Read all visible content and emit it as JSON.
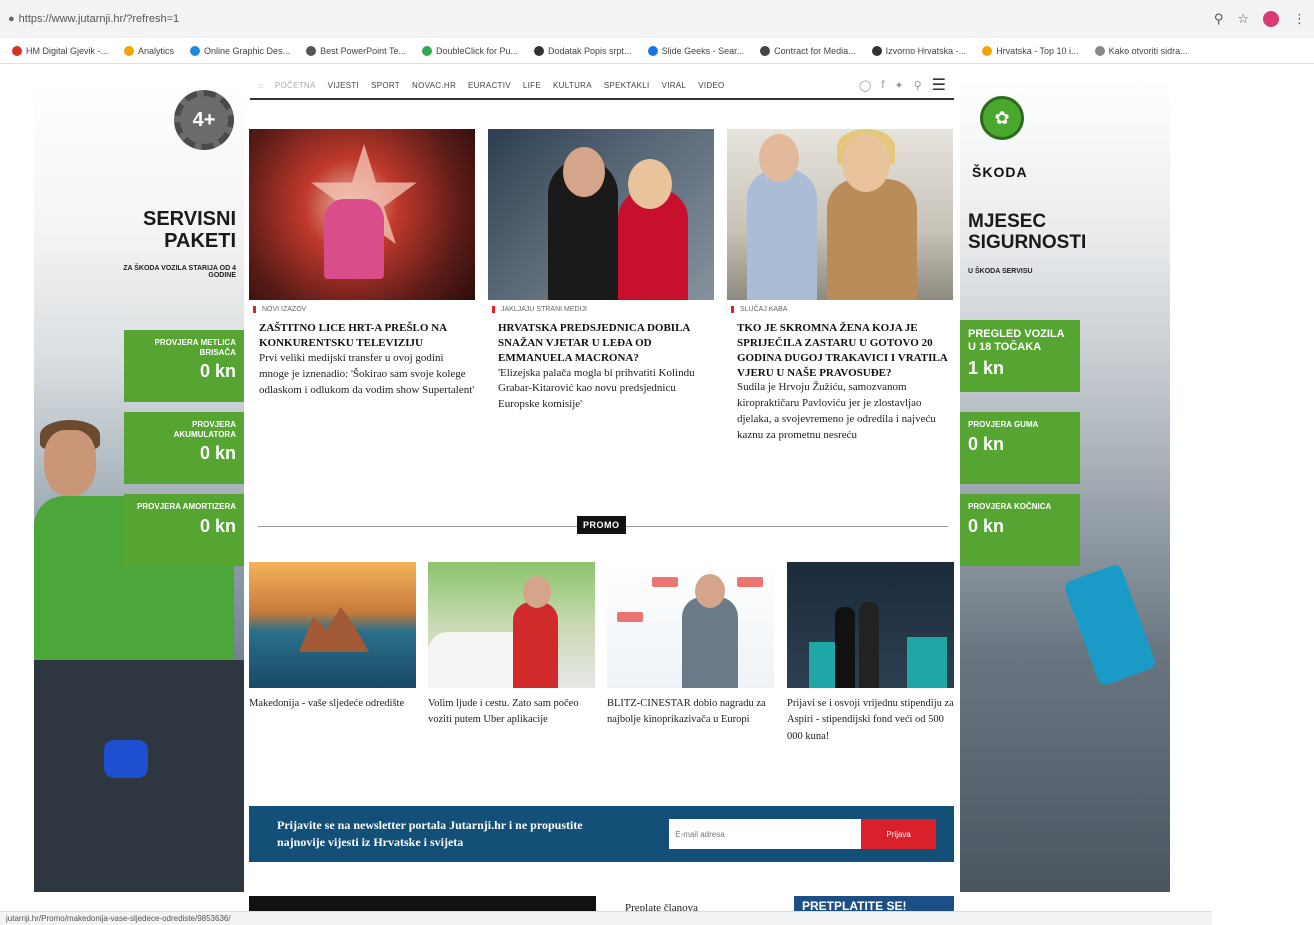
{
  "browser": {
    "url": "https://www.jutarnji.hr/?refresh=1",
    "bookmarks": [
      {
        "label": "HM Digital Gjevik -...",
        "color": "#d93025"
      },
      {
        "label": "Analytics",
        "color": "#f4a400"
      },
      {
        "label": "Online Graphic Des...",
        "color": "#1e88e5"
      },
      {
        "label": "Best PowerPoint Te...",
        "color": "#555555"
      },
      {
        "label": "DoubleClick for Pu...",
        "color": "#34a853"
      },
      {
        "label": "Dodatak Popis srpt...",
        "color": "#333333"
      },
      {
        "label": "Slide Geeks - Sear...",
        "color": "#1a73e8"
      },
      {
        "label": "Contract for Media...",
        "color": "#444444"
      },
      {
        "label": "Izvorno Hrvatska -...",
        "color": "#333333"
      },
      {
        "label": "Hrvatska - Top 10 i...",
        "color": "#f4a400"
      },
      {
        "label": "Kako otvoriti sidra...",
        "color": "#888888"
      }
    ],
    "status_url": "jutarnji.hr/Promo/makedonija-vase-sljedece-odrediste/9853636/"
  },
  "left_ad": {
    "badge": "4+",
    "title_line1": "SERVISNI",
    "title_line2": "PAKETI",
    "subtitle": "ZA ŠKODA VOZILA STARIJA OD 4 GODINE",
    "boxes": [
      {
        "label": "PROVJERA METLICA BRISAČA",
        "price": "0 kn"
      },
      {
        "label": "PROVJERA AKUMULATORA",
        "price": "0 kn"
      },
      {
        "label": "PROVJERA AMORTIZERA",
        "price": "0 kn"
      }
    ]
  },
  "right_ad": {
    "brand": "ŠKODA",
    "title_line1": "MJESEC",
    "title_line2": "SIGURNOSTI",
    "subtitle": "U ŠKODA SERVISU",
    "boxes": [
      {
        "label": "PREGLED VOZILA U 18 TOČAKA",
        "price": "1 kn"
      },
      {
        "label": "PROVJERA GUMA",
        "price": "0 kn"
      },
      {
        "label": "PROVJERA KOČNICA",
        "price": "0 kn"
      }
    ]
  },
  "nav": {
    "items": [
      "POČETNA",
      "VIJESTI",
      "SPORT",
      "NOVAC.HR",
      "EURACTIV",
      "LIFE",
      "KULTURA",
      "SPEKTAKLI",
      "VIRAL",
      "VIDEO"
    ]
  },
  "articles": [
    {
      "category": "NOVI IZAZOV",
      "title": "ZAŠTITNO LICE HRT-a PREŠLO NA KONKURENTSKU TELEVIZIJU",
      "lead": "Prvi veliki medijski transfer u ovoj godini mnoge je iznenadio: 'Šokirao sam svoje kolege odlaskom i odlukom da vodim show Supertalent'"
    },
    {
      "category": "JAKLJAJU STRANI MEDIJI",
      "title": "HRVATSKA PREDSJEDNICA DOBILA SNAŽAN VJETAR U LEĐA OD EMMANUELA MACRONA?",
      "lead": "'Elizejska palača mogla bi prihvatiti Kolindu Grabar-Kitarović kao novu predsjednicu Europske komisije'"
    },
    {
      "category": "SLUČAJ KABA",
      "title": "TKO JE SKROMNA ŽENA KOJA JE SPRIJEČILA ZASTARU U GOTOVO 20 GODINA DUGOJ TRAKAVICI I VRATILA VJERU U NAŠE PRAVOSUĐE?",
      "lead": "Sudila je Hrvoju Žužiću, samozvanom kiropraktičaru Pavloviću jer je zlostavljao djelaka, a svojevremeno je odredila i najveću kaznu za prometnu nesreću"
    }
  ],
  "promo": {
    "badge": "PROMO",
    "cards": [
      {
        "text": "Makedonija - vaše sljedeće odredište"
      },
      {
        "text": "Volim ljude i cestu. Zato sam počeo voziti putem Uber aplikacije"
      },
      {
        "text": "BLITZ-CINESTAR dobio nagradu za najbolje kinoprikazivača u Europi"
      },
      {
        "text": "Prijavi se i osvoji vrijednu stipendiju za Aspiri - stipendijski fond veći od 500 000 kuna!"
      }
    ]
  },
  "newsletter": {
    "text": "Prijavite se na newsletter portala Jutarnji.hr i ne propustite najnovije vijesti iz Hrvatske i svijeta",
    "placeholder": "E-mail adresa",
    "button": "Prijava"
  },
  "bottom": {
    "partial_text": "Preplate članova",
    "partial_banner": "PRETPLATITE SE!"
  }
}
